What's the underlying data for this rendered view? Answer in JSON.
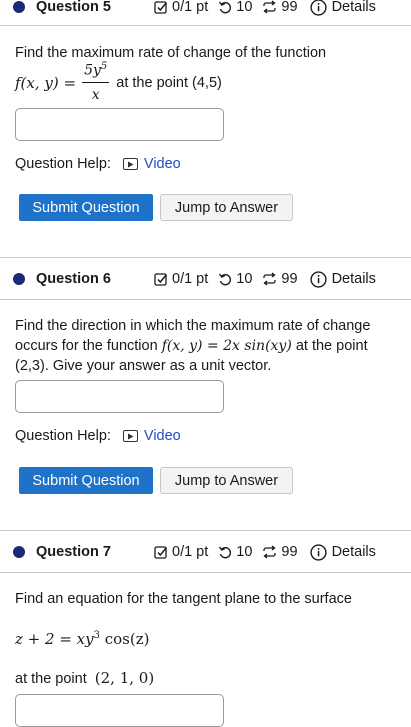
{
  "colors": {
    "dot": "#1b2a78",
    "submit_bg": "#1e72c8",
    "link": "#1f4ec7"
  },
  "common": {
    "points": "0/1 pt",
    "tries": "10",
    "submissions": "99",
    "details": "Details",
    "help_label": "Question Help:",
    "video_label": "Video",
    "submit_label": "Submit Question",
    "jump_label": "Jump to Answer"
  },
  "q5": {
    "title": "Question 5",
    "text1": "Find the maximum rate of change of the function",
    "fx": "f(x, y) =",
    "num": "5y",
    "num_exp": "5",
    "den": "x",
    "text2": "at the point (4,5)"
  },
  "q6": {
    "title": "Question 6",
    "text1": "Find the direction in which the maximum rate of change occurs for the function",
    "math": "f(x, y) = 2x sin(xy)",
    "text2": "at the point (2,3). Give your answer as a unit vector."
  },
  "q7": {
    "title": "Question 7",
    "text1": "Find an equation for the tangent plane to the surface",
    "eq_a": "z + 2 = xy",
    "eq_exp": "3",
    "eq_b": " cos(z)",
    "text2": "at the point",
    "point": "(2, 1, 0)"
  }
}
